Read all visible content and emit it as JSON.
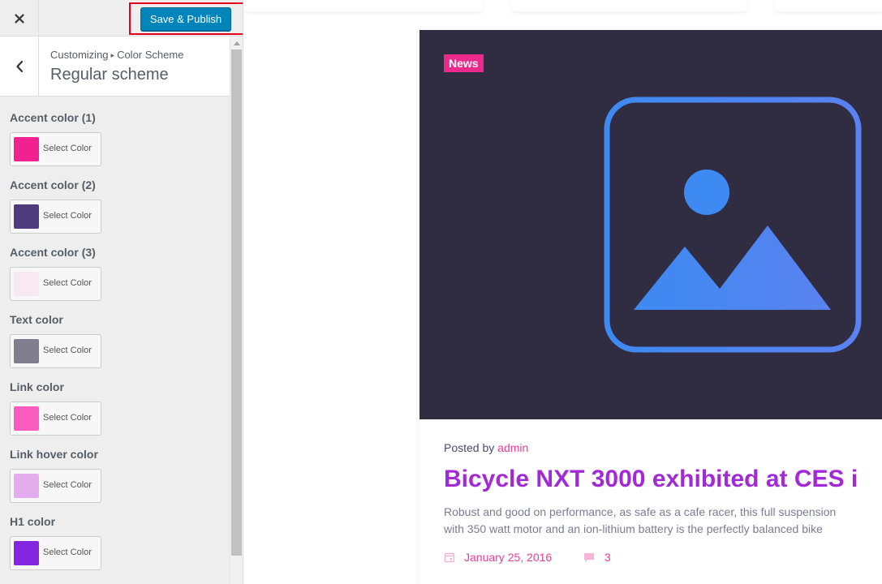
{
  "header": {
    "publish_label": "Save & Publish"
  },
  "section": {
    "breadcrumb_root": "Customizing",
    "breadcrumb_sep": "▸",
    "breadcrumb_parent": "Color Scheme",
    "title": "Regular scheme"
  },
  "controls": [
    {
      "label": "Accent color (1)",
      "button": "Select Color",
      "color": "#f1228f"
    },
    {
      "label": "Accent color (2)",
      "button": "Select Color",
      "color": "#4e3b7e"
    },
    {
      "label": "Accent color (3)",
      "button": "Select Color",
      "color": "#f8e8f1"
    },
    {
      "label": "Text color",
      "button": "Select Color",
      "color": "#7f7d8e"
    },
    {
      "label": "Link color",
      "button": "Select Color",
      "color": "#f85dbd"
    },
    {
      "label": "Link hover color",
      "button": "Select Color",
      "color": "#e3acec"
    },
    {
      "label": "H1 color",
      "button": "Select Color",
      "color": "#8425e2"
    }
  ],
  "preview": {
    "badge": "News",
    "posted_by": "Posted by",
    "author": "admin",
    "post_title": "Bicycle NXT 3000 exhibited at CES i",
    "excerpt_line1": "Robust and good on performance, as safe as a cafe racer, this full suspension",
    "excerpt_line2": "with 350 watt motor and an ion-lithium battery is the perfectly balanced bike",
    "date": "January 25, 2016",
    "comments": "3"
  },
  "colors": {
    "publish_bg": "#0085ba",
    "highlight_border": "#e4001c",
    "image_bg": "#302c41",
    "badge_bg": "#ec2a8d",
    "title_color": "#a12ad6",
    "link_color": "#e83e9e"
  },
  "icons": {
    "close": "close-icon",
    "back": "chevron-left-icon",
    "image_placeholder": "image-placeholder-icon",
    "calendar": "calendar-icon",
    "comment": "comment-icon"
  }
}
